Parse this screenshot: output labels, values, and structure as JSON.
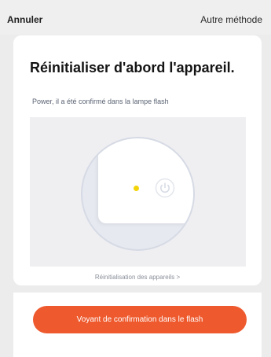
{
  "header": {
    "cancel_label": "Annuler",
    "other_method_label": "Autre méthode"
  },
  "main": {
    "title": "Réinitialiser d'abord l'appareil.",
    "subtitle": "Power, il a été confirmé dans la lampe flash",
    "illustration": {
      "led_color": "#f3d40a",
      "icon": "power-icon"
    },
    "reset_link": "Réinitialisation des appareils",
    "reset_link_icon": "chevron-right-icon"
  },
  "footer": {
    "confirm_button": "Voyant de confirmation dans le flash",
    "accent_color": "#ee5a2e"
  }
}
